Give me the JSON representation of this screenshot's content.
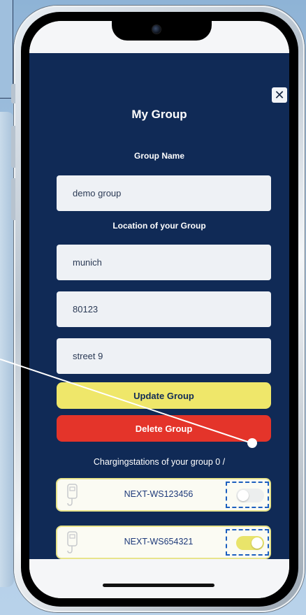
{
  "modal": {
    "title": "My Group",
    "close_glyph": "✕",
    "group_name_label": "Group Name",
    "group_name_value": "demo group",
    "location_label": "Location of your Group",
    "city_value": "munich",
    "zip_value": "80123",
    "street_value": "street 9",
    "update_button": "Update Group",
    "delete_button": "Delete Group",
    "stations_label": "Chargingstations of your group  0 /"
  },
  "stations": [
    {
      "name": "NEXT-WS123456",
      "enabled": false
    },
    {
      "name": "NEXT-WS654321",
      "enabled": true
    }
  ],
  "colors": {
    "modal_bg": "#102a56",
    "update_btn": "#efe76a",
    "delete_btn": "#e4342a",
    "toggle_on": "#e9e46a"
  },
  "icons": [
    "close-icon",
    "camera-icon",
    "charger-icon"
  ]
}
